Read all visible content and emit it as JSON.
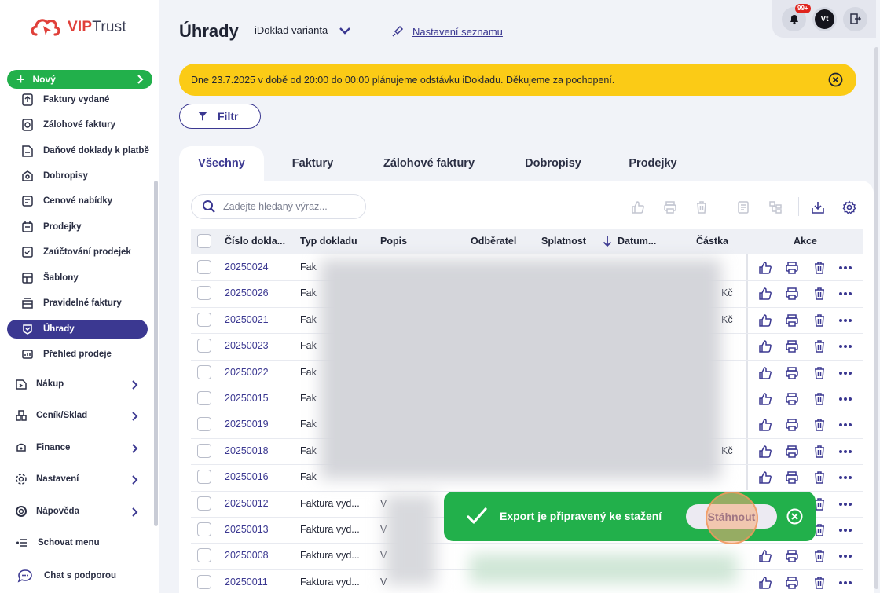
{
  "brand": {
    "logo_vip": "VIP",
    "logo_trust": "Trust"
  },
  "sidebar": {
    "new_label": "Nový",
    "sub_items": [
      {
        "label": "Faktury vydané",
        "icon": "invoice-out-icon"
      },
      {
        "label": "Zálohové faktury",
        "icon": "advance-invoice-icon"
      },
      {
        "label": "Daňové doklady k platbě",
        "icon": "tax-document-icon"
      },
      {
        "label": "Dobropisy",
        "icon": "credit-note-icon"
      },
      {
        "label": "Cenové nabídky",
        "icon": "quote-icon"
      },
      {
        "label": "Prodejky",
        "icon": "receipt-icon"
      },
      {
        "label": "Zaúčtování prodejek",
        "icon": "posting-icon"
      },
      {
        "label": "Šablony",
        "icon": "template-icon"
      },
      {
        "label": "Pravidelné faktury",
        "icon": "recurring-icon"
      },
      {
        "label": "Úhrady",
        "icon": "payment-icon",
        "active": true
      },
      {
        "label": "Přehled prodeje",
        "icon": "sales-overview-icon"
      }
    ],
    "main_items": [
      {
        "label": "Nákup",
        "icon": "purchase-icon"
      },
      {
        "label": "Ceník/Sklad",
        "icon": "warehouse-icon"
      },
      {
        "label": "Finance",
        "icon": "finance-icon"
      },
      {
        "label": "Nastavení",
        "icon": "gear-icon"
      },
      {
        "label": "Nápověda",
        "icon": "help-icon"
      }
    ],
    "hide_menu": "Schovat menu",
    "chat": "Chat s podporou"
  },
  "header": {
    "title": "Úhrady",
    "variant": "iDoklad varianta",
    "settings_link": "Nastavení seznamu",
    "notif_count": "99+",
    "avatar_initials": "Vt"
  },
  "banner": {
    "text": "Dne 23.7.2025 v době od 20:00 do 00:00 plánujeme odstávku iDokladu. Děkujeme za pochopení."
  },
  "filter": {
    "label": "Filtr"
  },
  "tabs": [
    "Všechny",
    "Faktury",
    "Zálohové faktury",
    "Dobropisy",
    "Prodejky"
  ],
  "search": {
    "placeholder": "Zadejte hledaný výraz..."
  },
  "table": {
    "columns": [
      "Číslo dokla...",
      "Typ dokladu",
      "Popis",
      "Odběratel",
      "Splatnost",
      "Datum...",
      "Částka",
      "Akce"
    ],
    "rows": [
      {
        "number": "20250024",
        "type": "Fak",
        "extra": ""
      },
      {
        "number": "20250026",
        "type": "Fak",
        "extra": "Kč"
      },
      {
        "number": "20250021",
        "type": "Fak",
        "extra": "Kč"
      },
      {
        "number": "20250023",
        "type": "Fak",
        "extra": ""
      },
      {
        "number": "20250022",
        "type": "Fak",
        "extra": ""
      },
      {
        "number": "20250015",
        "type": "Fak",
        "extra": ""
      },
      {
        "number": "20250019",
        "type": "Fak",
        "extra": ""
      },
      {
        "number": "20250018",
        "type": "Fak",
        "extra": "Kč"
      },
      {
        "number": "20250016",
        "type": "Fak",
        "extra": ""
      },
      {
        "number": "20250012",
        "type": "Faktura vyd...",
        "extra": "V"
      },
      {
        "number": "20250013",
        "type": "Faktura vyd...",
        "extra": "V"
      },
      {
        "number": "20250008",
        "type": "Faktura vyd...",
        "extra": "V"
      },
      {
        "number": "20250011",
        "type": "Faktura vyd...",
        "extra": "V"
      }
    ]
  },
  "toast": {
    "message": "Export je připravený ke stažení",
    "button": "Stáhnout"
  },
  "colors": {
    "primary": "#3b3891",
    "success": "#22b04b",
    "warning": "#fbcb16",
    "brand_red": "#e0403a"
  }
}
